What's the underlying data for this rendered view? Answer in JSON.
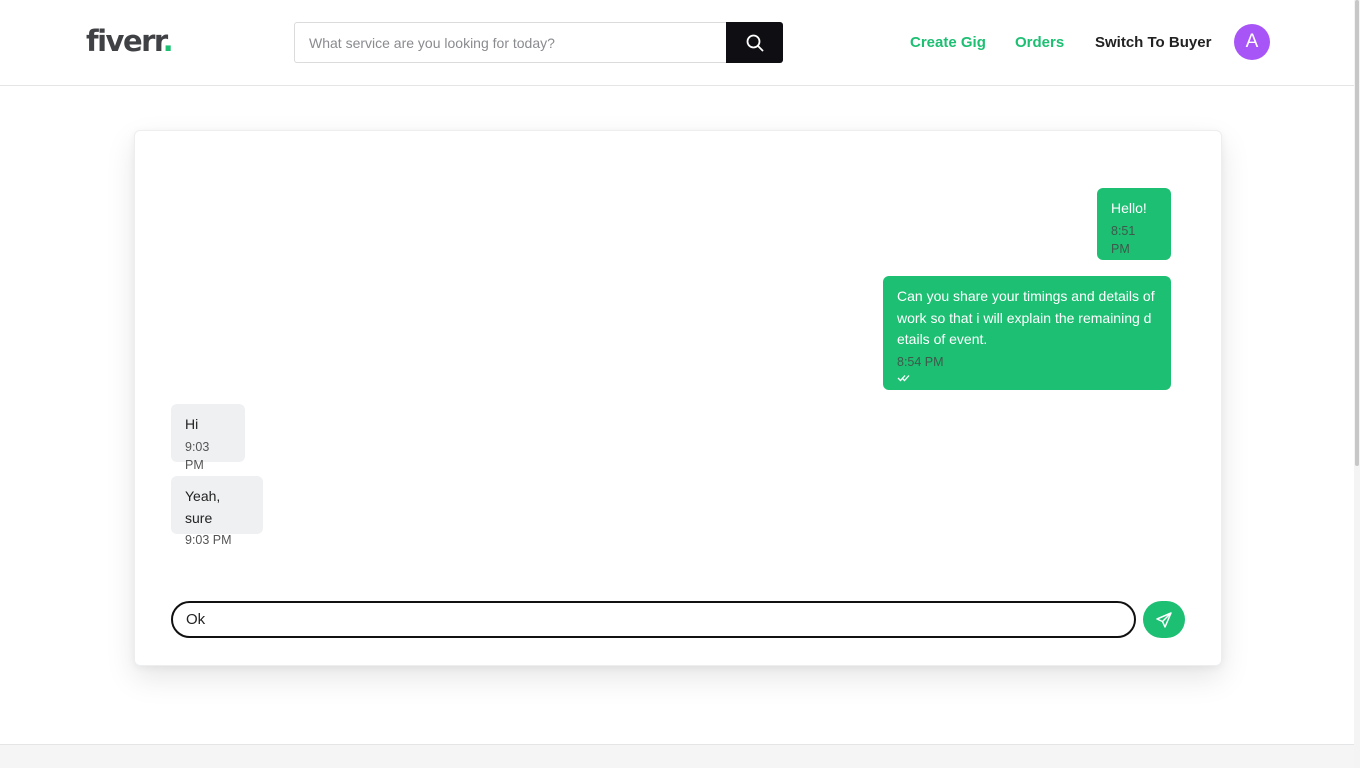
{
  "header": {
    "logo_text": "fiverr",
    "logo_dot": ".",
    "search_placeholder": "What service are you looking for today?",
    "nav": {
      "create_gig": "Create Gig",
      "orders": "Orders",
      "switch": "Switch To Buyer"
    },
    "avatar_letter": "A"
  },
  "chat": {
    "messages": [
      {
        "direction": "outgoing",
        "text": "Hello!",
        "time": "8:51 PM",
        "status": "double-check-icon"
      },
      {
        "direction": "outgoing",
        "text": "Can you share your timings and details of work so that i will explain the remaining details of event.",
        "time": "8:54 PM",
        "status": "double-check-icon"
      },
      {
        "direction": "incoming",
        "text": "Hi",
        "time": "9:03 PM"
      },
      {
        "direction": "incoming",
        "text": "Yeah, sure",
        "time": "9:03 PM"
      }
    ],
    "composer_value": "Ok"
  },
  "colors": {
    "brand_green": "#1dbf73",
    "avatar_purple": "#a855f7",
    "search_button": "#0e0e13",
    "incoming_bubble": "#eff0f2"
  },
  "icons": {
    "search": "search-icon",
    "send": "send-icon"
  }
}
